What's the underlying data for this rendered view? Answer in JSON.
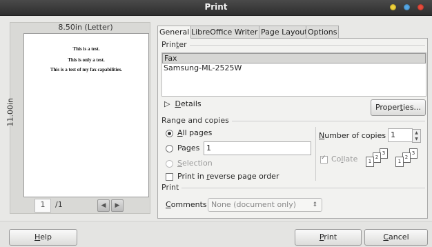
{
  "window": {
    "title": "Print"
  },
  "preview": {
    "paper_size": "8.50in (Letter)",
    "paper_height": "11.00in",
    "page_lines": [
      "This is a test.",
      "This is only a test.",
      "This is a test of my fax capabilities."
    ],
    "current_page": "1",
    "total_pages": "/1"
  },
  "tabs": [
    "General",
    "LibreOffice Writer",
    "Page Layout",
    "Options"
  ],
  "printer": {
    "group_label_pre": "Prin",
    "group_label_ul": "t",
    "group_label_post": "er",
    "items": [
      "Fax",
      "Samsung-ML-2525W"
    ],
    "details_ul": "D",
    "details_rest": "etails",
    "properties_pre": "Proper",
    "properties_ul": "t",
    "properties_post": "ies..."
  },
  "range": {
    "group_label": "Range and copies",
    "all_pages_ul": "A",
    "all_pages_rest": "ll pages",
    "pages_pre": "Pa",
    "pages_ul": "g",
    "pages_post": "es",
    "pages_value": "1",
    "selection_ul": "S",
    "selection_rest": "election",
    "reverse_pre": "Print in ",
    "reverse_ul": "r",
    "reverse_post": "everse page order",
    "copies_ul": "N",
    "copies_rest": "umber of copies",
    "copies_value": "1",
    "collate_pre": "Co",
    "collate_ul": "l",
    "collate_post": "late"
  },
  "print_group": {
    "label": "Print",
    "comments_ul": "C",
    "comments_rest": "omments",
    "comments_value": "None (document only)"
  },
  "footer": {
    "help_ul": "H",
    "help_rest": "elp",
    "print_ul": "P",
    "print_rest": "rint",
    "cancel_ul": "C",
    "cancel_rest": "ancel"
  }
}
